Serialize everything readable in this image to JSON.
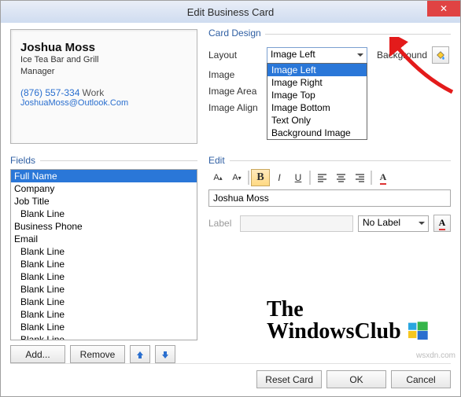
{
  "window": {
    "title": "Edit Business Card"
  },
  "card": {
    "name": "Joshua Moss",
    "line1": "Ice Tea Bar and Grill",
    "line2": "Manager",
    "phone": "(876) 557-334",
    "phone_type": "Work",
    "email": "JoshuaMoss@Outlook.Com"
  },
  "design": {
    "group": "Card Design",
    "labels": {
      "layout": "Layout",
      "image": "Image",
      "image_area": "Image Area",
      "image_align": "Image Align",
      "background": "Background"
    },
    "layout_selected": "Image Left",
    "layout_options": [
      "Image Left",
      "Image Right",
      "Image Top",
      "Image Bottom",
      "Text Only",
      "Background Image"
    ]
  },
  "fields": {
    "group": "Fields",
    "items": [
      {
        "text": "Full Name",
        "selected": true,
        "indent": false
      },
      {
        "text": "Company",
        "selected": false,
        "indent": false
      },
      {
        "text": "Job Title",
        "selected": false,
        "indent": false
      },
      {
        "text": "Blank Line",
        "selected": false,
        "indent": true
      },
      {
        "text": "Business Phone",
        "selected": false,
        "indent": false
      },
      {
        "text": "Email",
        "selected": false,
        "indent": false
      },
      {
        "text": "Blank Line",
        "selected": false,
        "indent": true
      },
      {
        "text": "Blank Line",
        "selected": false,
        "indent": true
      },
      {
        "text": "Blank Line",
        "selected": false,
        "indent": true
      },
      {
        "text": "Blank Line",
        "selected": false,
        "indent": true
      },
      {
        "text": "Blank Line",
        "selected": false,
        "indent": true
      },
      {
        "text": "Blank Line",
        "selected": false,
        "indent": true
      },
      {
        "text": "Blank Line",
        "selected": false,
        "indent": true
      },
      {
        "text": "Blank Line",
        "selected": false,
        "indent": true
      }
    ],
    "add": "Add...",
    "remove": "Remove"
  },
  "edit": {
    "group": "Edit",
    "value": "Joshua Moss",
    "label_text": "Label",
    "nolabel": "No Label"
  },
  "footer": {
    "reset": "Reset Card",
    "ok": "OK",
    "cancel": "Cancel"
  },
  "watermark": {
    "line1": "The",
    "line2": "WindowsClub"
  },
  "credit": "wsxdn.com"
}
